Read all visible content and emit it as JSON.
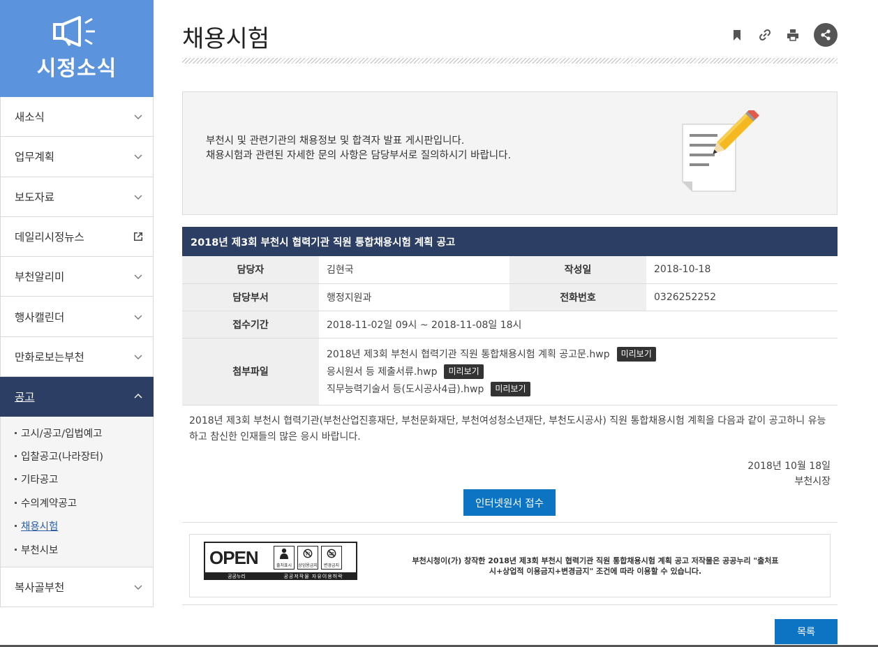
{
  "sidebar": {
    "title": "시정소식",
    "items": [
      {
        "label": "새소식"
      },
      {
        "label": "업무계획"
      },
      {
        "label": "보도자료"
      },
      {
        "label": "데일리시정뉴스"
      },
      {
        "label": "부천알리미"
      },
      {
        "label": "행사캘린더"
      },
      {
        "label": "만화로보는부천"
      },
      {
        "label": "공고"
      },
      {
        "label": "복사골부천"
      }
    ],
    "sub_items": [
      {
        "label": "고시/공고/입법예고"
      },
      {
        "label": "입찰공고(나라장터)"
      },
      {
        "label": "기타공고"
      },
      {
        "label": "수의계약공고"
      },
      {
        "label": "채용시험"
      },
      {
        "label": "부천시보"
      }
    ],
    "active_item": "공고",
    "current_sub": "채용시험"
  },
  "page": {
    "title": "채용시험",
    "icons": [
      "bookmark-icon",
      "link-icon",
      "print-icon",
      "share-icon"
    ]
  },
  "intro": {
    "line1": "부천시 및 관련기관의 채용정보 및 합격자 발표 게시판입니다.",
    "line2": "채용시험과 관련된 자세한 문의 사항은 담당부서로 질의하시기 바랍니다."
  },
  "post": {
    "title": "2018년 제3회 부천시 협력기관 직원 통합채용시험 계획 공고",
    "labels": {
      "manager": "담당자",
      "date": "작성일",
      "department": "담당부서",
      "phone": "전화번호",
      "period": "접수기간",
      "attachments": "첨부파일"
    },
    "manager": "김현국",
    "date": "2018-10-18",
    "department": "행정지원과",
    "phone": "0326252252",
    "period": "2018-11-02일 09시 ~ 2018-11-08일 18시",
    "files": [
      {
        "name": "2018년 제3회 부천시 협력기관 직원 통합채용시험 계획 공고문.hwp",
        "preview": "미리보기"
      },
      {
        "name": "응시원서 등 제출서류.hwp",
        "preview": "미리보기"
      },
      {
        "name": "직무능력기술서 등(도시공사4급).hwp",
        "preview": "미리보기"
      }
    ],
    "body": "2018년 제3회 부천시 협력기관(부천산업진흥재단, 부천문화재단, 부천여성청소년재단, 부천도시공사) 직원 통합채용시험 계획을 다음과 같이 공고하니 유능하고 참신한 인재들의 많은 응시 바랍니다.",
    "sign_date": "2018년 10월 18일",
    "sign_name": "부천시장",
    "apply_button": "인터넷원서 접수"
  },
  "license": {
    "logo_text": "OPEN",
    "logo_caption": "공공누리",
    "logo_sub": "공공저작물 자유이용허락",
    "mark1": "출처표시",
    "mark2": "상업용금지",
    "mark3": "변경금지",
    "text": "부천시청이(가) 창작한 2018년 제3회 부천시 협력기관 직원 통합채용시험 계획 공고 저작물은 공공누리 \"출처표시+상업적 이용금지+변경금지\" 조건에 따라 이용할 수 있습니다."
  },
  "footer": {
    "list_button": "목록"
  },
  "colors": {
    "sidebar_header": "#5b93dc",
    "navy": "#2c3e63",
    "button_blue": "#0c74c2"
  }
}
